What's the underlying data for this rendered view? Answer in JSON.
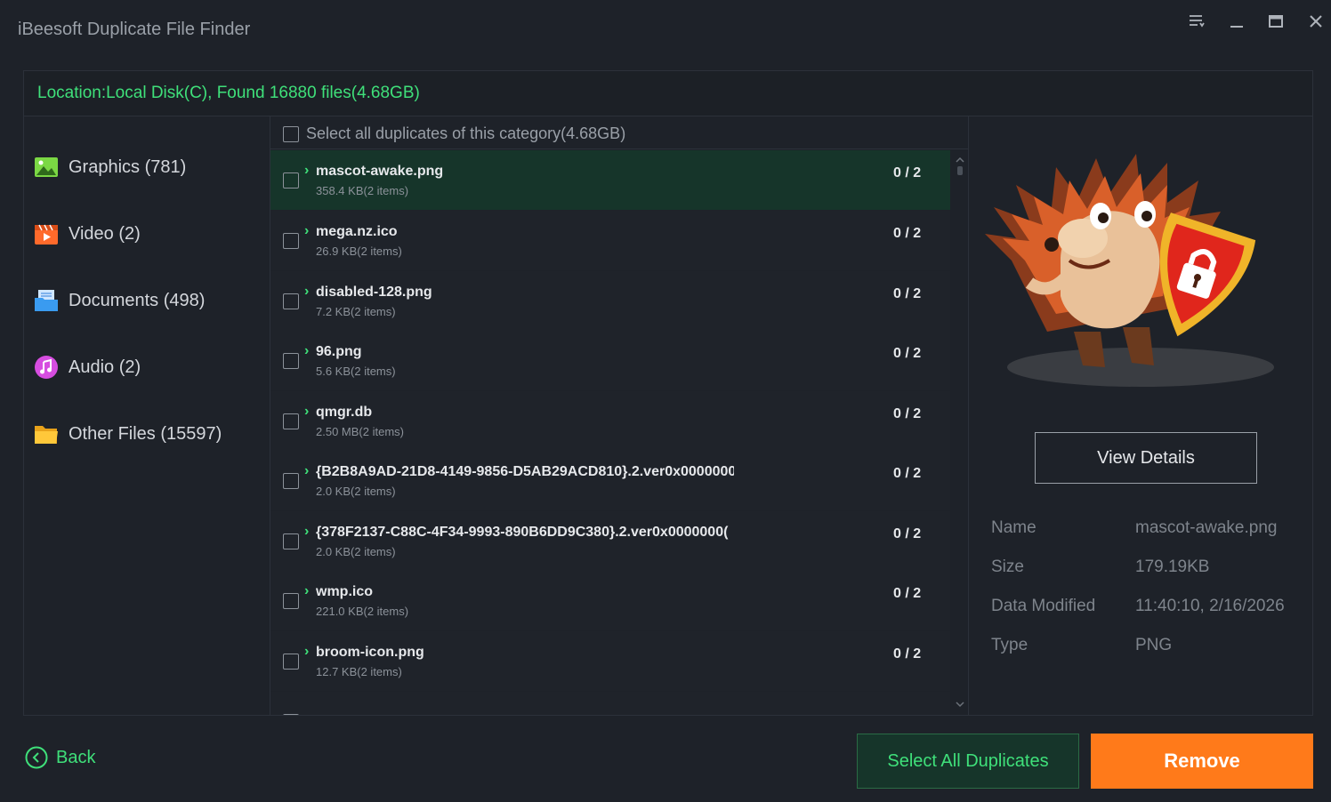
{
  "app": {
    "title": "iBeesoft Duplicate File Finder"
  },
  "location": {
    "text": "Location:Local Disk(C), Found 16880 files(4.68GB)"
  },
  "categories": [
    {
      "label": "Graphics (781)",
      "icon": "image-icon"
    },
    {
      "label": "Video (2)",
      "icon": "video-icon"
    },
    {
      "label": "Documents (498)",
      "icon": "documents-icon"
    },
    {
      "label": "Audio (2)",
      "icon": "audio-icon"
    },
    {
      "label": "Other Files (15597)",
      "icon": "folder-icon"
    }
  ],
  "list": {
    "select_all_label": "Select all duplicates of this category(4.68GB)",
    "rows": [
      {
        "name": "mascot-awake.png",
        "meta": "358.4 KB(2 items)",
        "count": "0 / 2",
        "selected": true
      },
      {
        "name": "mega.nz.ico",
        "meta": "26.9 KB(2 items)",
        "count": "0 / 2",
        "selected": false
      },
      {
        "name": "disabled-128.png",
        "meta": "7.2 KB(2 items)",
        "count": "0 / 2",
        "selected": false
      },
      {
        "name": "96.png",
        "meta": "5.6 KB(2 items)",
        "count": "0 / 2",
        "selected": false
      },
      {
        "name": "qmgr.db",
        "meta": "2.50 MB(2 items)",
        "count": "0 / 2",
        "selected": false
      },
      {
        "name": "{B2B8A9AD-21D8-4149-9856-D5AB29ACD810}.2.ver0x0000000(",
        "meta": "2.0 KB(2 items)",
        "count": "0 / 2",
        "selected": false
      },
      {
        "name": "{378F2137-C88C-4F34-9993-890B6DD9C380}.2.ver0x0000000(",
        "meta": "2.0 KB(2 items)",
        "count": "0 / 2",
        "selected": false
      },
      {
        "name": "wmp.ico",
        "meta": "221.0 KB(2 items)",
        "count": "0 / 2",
        "selected": false
      },
      {
        "name": "broom-icon.png",
        "meta": "12.7 KB(2 items)",
        "count": "0 / 2",
        "selected": false
      }
    ]
  },
  "details": {
    "view_details_label": "View Details",
    "fields": [
      {
        "key": "Name",
        "value": "mascot-awake.png"
      },
      {
        "key": "Size",
        "value": "179.19KB"
      },
      {
        "key": "Data Modified",
        "value": "11:40:10,  2/16/2026"
      },
      {
        "key": "Type",
        "value": "PNG"
      }
    ]
  },
  "footer": {
    "back_label": "Back",
    "select_all_label": "Select All Duplicates",
    "remove_label": "Remove"
  },
  "colors": {
    "accent_green": "#3fe07a",
    "remove_orange": "#ff7a1a",
    "selected_row": "#16352a",
    "background": "#1e2229"
  }
}
